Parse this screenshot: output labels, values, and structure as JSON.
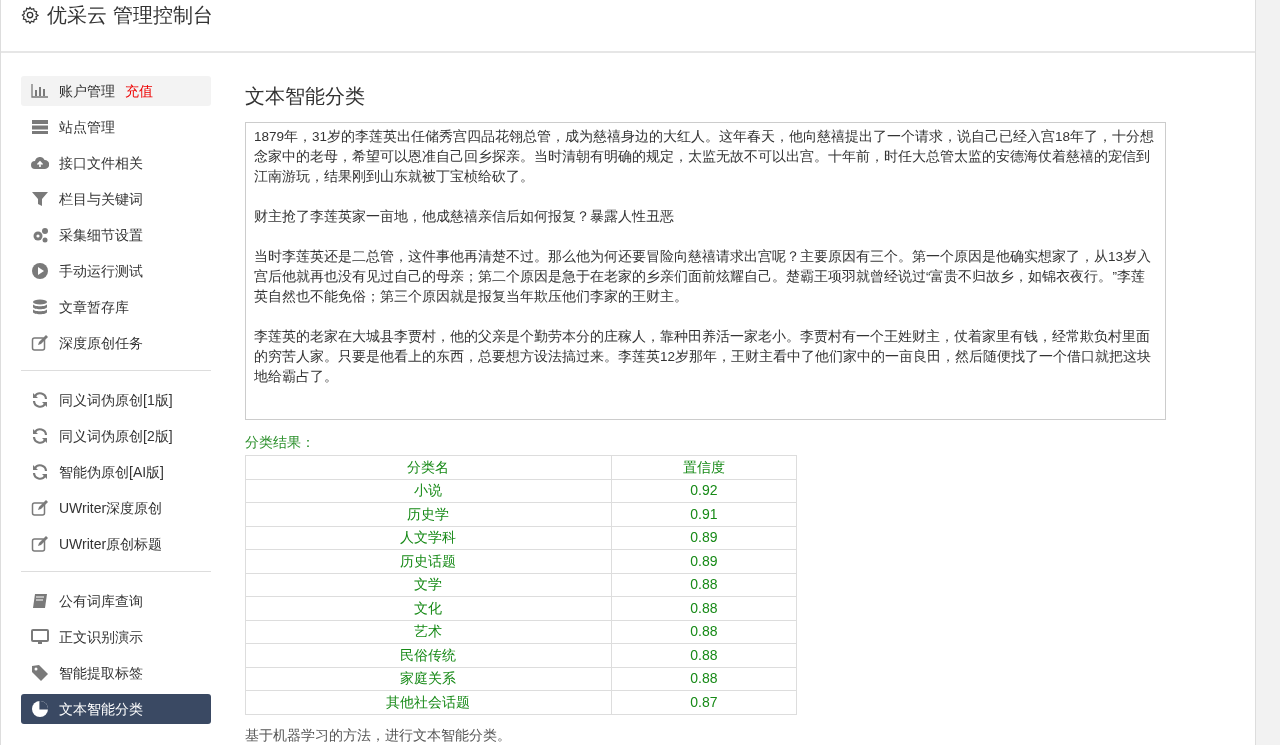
{
  "header": {
    "title": "优采云 管理控制台"
  },
  "sidebar": {
    "groups": [
      {
        "items": [
          {
            "label": "账户管理",
            "tag": "充值",
            "hovered": true,
            "selected": false
          },
          {
            "label": "站点管理",
            "hovered": false,
            "selected": false
          },
          {
            "label": "接口文件相关",
            "hovered": false,
            "selected": false
          },
          {
            "label": "栏目与关键词",
            "hovered": false,
            "selected": false
          },
          {
            "label": "采集细节设置",
            "hovered": false,
            "selected": false
          },
          {
            "label": "手动运行测试",
            "hovered": false,
            "selected": false
          },
          {
            "label": "文章暂存库",
            "hovered": false,
            "selected": false
          },
          {
            "label": "深度原创任务",
            "hovered": false,
            "selected": false
          }
        ]
      },
      {
        "items": [
          {
            "label": "同义词伪原创[1版]",
            "hovered": false,
            "selected": false
          },
          {
            "label": "同义词伪原创[2版]",
            "hovered": false,
            "selected": false
          },
          {
            "label": "智能伪原创[AI版]",
            "hovered": false,
            "selected": false
          },
          {
            "label": "UWriter深度原创",
            "hovered": false,
            "selected": false
          },
          {
            "label": "UWriter原创标题",
            "hovered": false,
            "selected": false
          }
        ]
      },
      {
        "items": [
          {
            "label": "公有词库查询",
            "hovered": false,
            "selected": false
          },
          {
            "label": "正文识别演示",
            "hovered": false,
            "selected": false
          },
          {
            "label": "智能提取标签",
            "hovered": false,
            "selected": false
          },
          {
            "label": "文本智能分类",
            "hovered": false,
            "selected": true
          }
        ]
      }
    ]
  },
  "main": {
    "title": "文本智能分类",
    "text_input": {
      "paragraphs": [
        "1879年，31岁的李莲英出任储秀宫四品花翎总管，成为慈禧身边的大红人。这年春天，他向慈禧提出了一个请求，说自己已经入宫18年了，十分想念家中的老母，希望可以恩准自己回乡探亲。当时清朝有明确的规定，太监无故不可以出宫。十年前，时任大总管太监的安德海仗着慈禧的宠信到江南游玩，结果刚到山东就被丁宝桢给砍了。",
        "财主抢了李莲英家一亩地，他成慈禧亲信后如何报复？暴露人性丑恶",
        "当时李莲英还是二总管，这件事他再清楚不过。那么他为何还要冒险向慈禧请求出宫呢？主要原因有三个。第一个原因是他确实想家了，从13岁入宫后他就再也没有见过自己的母亲；第二个原因是急于在老家的乡亲们面前炫耀自己。楚霸王项羽就曾经说过“富贵不归故乡，如锦衣夜行。”李莲英自然也不能免俗；第三个原因就是报复当年欺压他们李家的王财主。",
        "李莲英的老家在大城县李贾村，他的父亲是个勤劳本分的庄稼人，靠种田养活一家老小。李贾村有一个王姓财主，仗着家里有钱，经常欺负村里面的穷苦人家。只要是他看上的东西，总要想方设法搞过来。李莲英12岁那年，王财主看中了他们家中的一亩良田，然后随便找了一个借口就把这块地给霸占了。"
      ]
    },
    "result_label": "分类结果：",
    "table": {
      "columns": [
        "分类名",
        "置信度"
      ],
      "rows": [
        [
          "小说",
          "0.92"
        ],
        [
          "历史学",
          "0.91"
        ],
        [
          "人文学科",
          "0.89"
        ],
        [
          "历史话题",
          "0.89"
        ],
        [
          "文学",
          "0.88"
        ],
        [
          "文化",
          "0.88"
        ],
        [
          "艺术",
          "0.88"
        ],
        [
          "民俗传统",
          "0.88"
        ],
        [
          "家庭关系",
          "0.88"
        ],
        [
          "其他社会话题",
          "0.87"
        ]
      ]
    },
    "footnote": "基于机器学习的方法，进行文本智能分类。"
  }
}
